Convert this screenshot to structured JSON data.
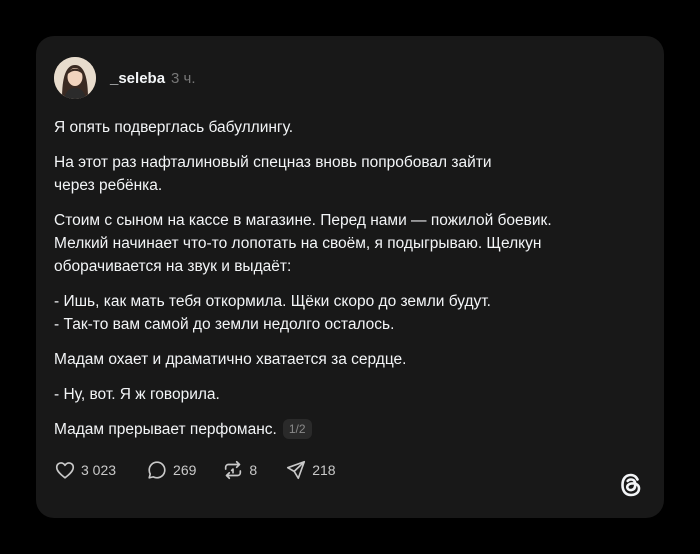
{
  "post": {
    "username": "_seleba",
    "time": "3 ч.",
    "paragraphs": [
      "Я опять подверглась бабуллингу.",
      "На этот раз нафталиновый спецназ вновь попробовал зайти\nчерез ребёнка.",
      "Стоим с сыном на кассе в магазине. Перед нами — пожилой боевик.\nМелкий начинает что-то лопотать на своём, я подыгрываю. Щелкун\nоборачивается на звук и выдаёт:",
      "- Ишь, как мать тебя откормила. Щёки скоро до земли будут.\n- Так-то вам самой до земли недолго осталось.",
      "Мадам охает и драматично хватается за сердце.",
      "- Ну, вот. Я ж говорила.",
      "Мадам прерывает перфоманс."
    ],
    "page_indicator": "1/2"
  },
  "actions": {
    "likes": "3 023",
    "comments": "269",
    "reposts": "8",
    "shares": "218"
  },
  "icons": {
    "like": "heart-icon",
    "comment": "comment-bubble-icon",
    "repost": "repost-icon",
    "share": "send-icon",
    "logo": "threads-logo-icon"
  },
  "colors": {
    "background": "#000000",
    "card": "#181818",
    "text": "#f3f5f7",
    "muted": "#777777"
  }
}
